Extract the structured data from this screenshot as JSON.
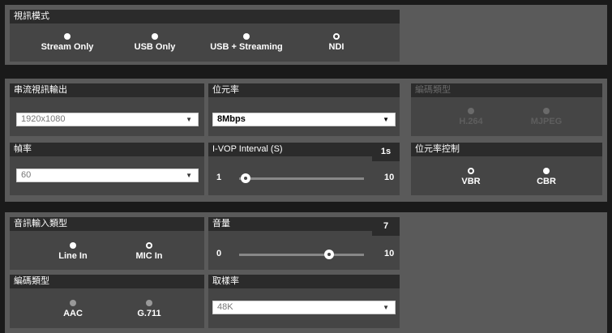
{
  "video_mode": {
    "title": "視訊模式",
    "options": [
      "Stream Only",
      "USB Only",
      "USB + Streaming",
      "NDI"
    ],
    "selected": "NDI"
  },
  "stream_output": {
    "title": "串流視訊輸出",
    "resolution": "1920x1080"
  },
  "bitrate": {
    "title": "位元率",
    "value": "8Mbps"
  },
  "encoding_type": {
    "title": "編碼類型",
    "options": [
      "H.264",
      "MJPEG"
    ],
    "disabled": true
  },
  "frame_rate": {
    "title": "幀率",
    "value": "60"
  },
  "ivop": {
    "title": "I-VOP Interval (S)",
    "value": "1s",
    "min": "1",
    "max": "10",
    "level": 1
  },
  "bitrate_control": {
    "title": "位元率控制",
    "options": [
      "VBR",
      "CBR"
    ],
    "selected": "VBR"
  },
  "audio_input": {
    "title": "音訊輸入類型",
    "options": [
      "Line In",
      "MIC In"
    ],
    "selected": "MIC In"
  },
  "volume": {
    "title": "音量",
    "value": "7",
    "min": "0",
    "max": "10",
    "level": 7
  },
  "audio_encoding": {
    "title": "編碼類型",
    "options": [
      "AAC",
      "G.711"
    ]
  },
  "sample_rate": {
    "title": "取樣率",
    "value": "48K"
  },
  "colors": {
    "page_bg": "#1a1a1a",
    "section_bg": "#5a5a5a",
    "panel_bg": "#454545",
    "header_bg": "#2b2b2b"
  }
}
